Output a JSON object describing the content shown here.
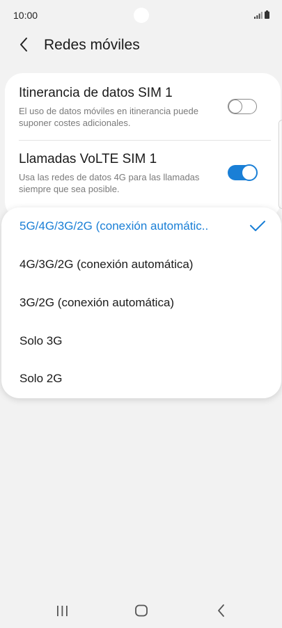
{
  "status_bar": {
    "time": "10:00",
    "icons": [
      "signal-icon",
      "battery-icon"
    ]
  },
  "header": {
    "title": "Redes móviles",
    "back_icon": "chevron-left-icon"
  },
  "settings": [
    {
      "title": "Itinerancia de datos SIM 1",
      "description": "El uso de datos móviles en itinerancia puede suponer costes adicionales.",
      "toggle_on": false
    },
    {
      "title": "Llamadas VoLTE SIM 1",
      "description": "Usa las redes de datos 4G para las llamadas siempre que sea posible.",
      "toggle_on": true
    }
  ],
  "network_mode_menu": {
    "options": [
      {
        "label": "5G/4G/3G/2G (conexión automátic..",
        "selected": true
      },
      {
        "label": "4G/3G/2G (conexión automática)",
        "selected": false
      },
      {
        "label": "3G/2G (conexión automática)",
        "selected": false
      },
      {
        "label": "Solo 3G",
        "selected": false
      },
      {
        "label": "Solo 2G",
        "selected": false
      }
    ]
  },
  "nav_bar": {
    "icons": [
      "recents-icon",
      "home-icon",
      "back-icon"
    ]
  },
  "colors": {
    "accent": "#1a7fd6",
    "background": "#f2f2f2",
    "card": "#ffffff",
    "secondary_text": "#7a7a7a"
  }
}
